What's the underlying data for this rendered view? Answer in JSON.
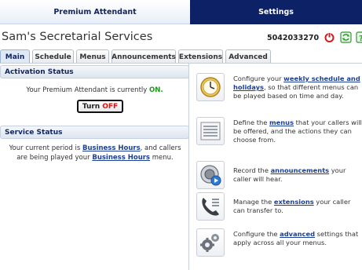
{
  "top_tabs": {
    "premium": "Premium Attendant",
    "settings": "Settings"
  },
  "header": {
    "company": "Sam's Secretarial Services",
    "phone": "5042033270"
  },
  "subtabs": [
    "Main",
    "Schedule",
    "Menus",
    "Announcements",
    "Extensions",
    "Advanced"
  ],
  "activation": {
    "title": "Activation Status",
    "text_prefix": "Your Premium Attendant is currently",
    "state": "ON.",
    "button_prefix": "Turn",
    "button_action": "OFF"
  },
  "service": {
    "title": "Service Status",
    "t1": "Your current period is",
    "link1": "Business Hours",
    "t2": ", and callers are being played your",
    "link2": "Business Hours",
    "t3": " menu."
  },
  "items": [
    {
      "icon": "clock-icon",
      "pre": "Configure your",
      "link": "weekly schedule and holidays",
      "post": ", so that different menus can be played based on time and day."
    },
    {
      "icon": "menu-list-icon",
      "pre": "Define the",
      "link": "menus",
      "post": " that your callers will be offered, and the actions they can choose from."
    },
    {
      "icon": "speaker-icon",
      "pre": "Record the",
      "link": "announcements",
      "post": " your caller will hear."
    },
    {
      "icon": "phone-icon",
      "pre": "Manage the",
      "link": "extensions",
      "post": " your caller can transfer to."
    },
    {
      "icon": "gears-icon",
      "pre": "Configure the",
      "link": "advanced",
      "post": " settings that apply across all your menus."
    }
  ],
  "colors": {
    "navy": "#0d2166",
    "link": "#1c3f94",
    "on": "#1a9a1a",
    "off": "#e01010"
  }
}
